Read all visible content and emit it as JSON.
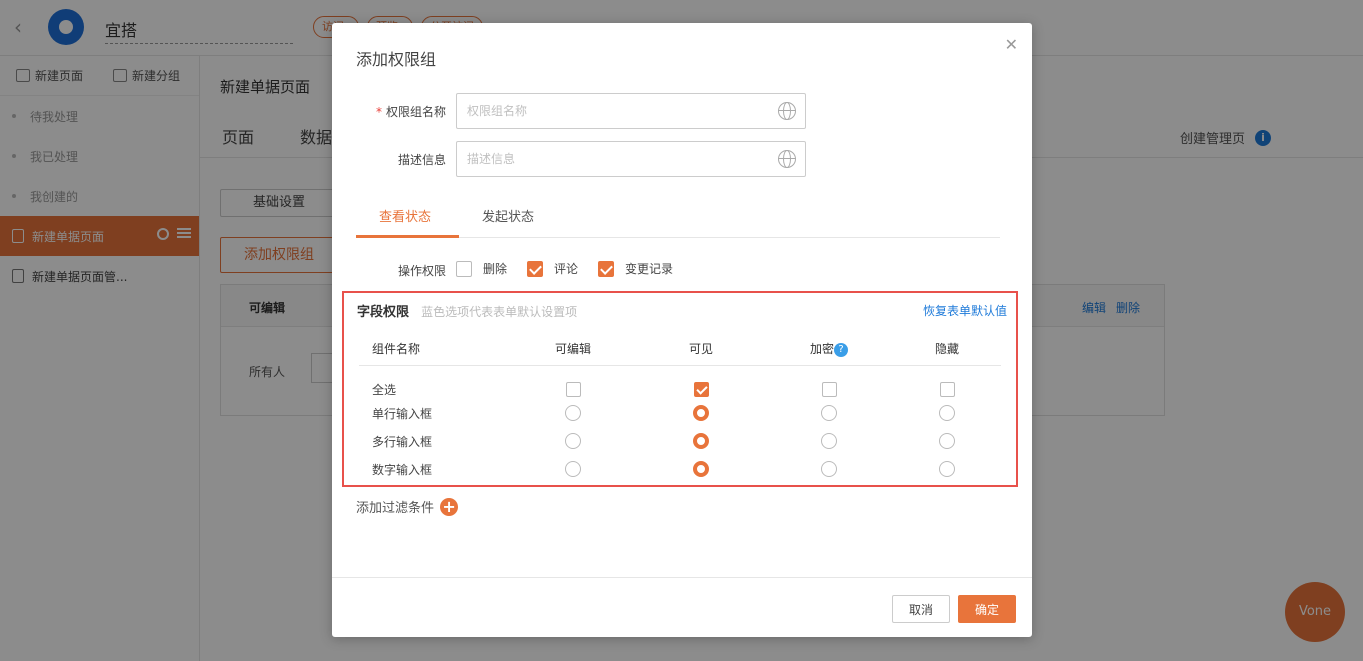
{
  "colors": {
    "accent": "#e8743b",
    "link": "#1e7ad9",
    "highlight_border": "#e8514b"
  },
  "app": {
    "title": "宜搭",
    "pills": [
      "访问",
      "预览",
      "公开访问"
    ]
  },
  "sidebar": {
    "new_page": "新建页面",
    "new_group": "新建分组",
    "items": [
      {
        "label": "待我处理"
      },
      {
        "label": "我已处理"
      },
      {
        "label": "我创建的"
      },
      {
        "label": "新建单据页面"
      },
      {
        "label": "新建单据页面管..."
      }
    ]
  },
  "main": {
    "page_name": "新建单据页面",
    "tabs": [
      "页面",
      "数据"
    ],
    "manage_link": "创建管理页",
    "basic_settings": "基础设置",
    "add_group": "添加权限组",
    "panel": {
      "col_editable": "可编辑",
      "edit": "编辑",
      "delete": "删除",
      "row_everyone": "所有人"
    }
  },
  "dialog": {
    "title": "添加权限组",
    "name_label": "权限组名称",
    "name_placeholder": "权限组名称",
    "desc_label": "描述信息",
    "desc_placeholder": "描述信息",
    "tabs": [
      "查看状态",
      "发起状态"
    ],
    "op_label": "操作权限",
    "ops": [
      {
        "label": "删除",
        "checked": false
      },
      {
        "label": "评论",
        "checked": true
      },
      {
        "label": "变更记录",
        "checked": true
      }
    ],
    "field_perm": {
      "title": "字段权限",
      "hint": "蓝色选项代表表单默认设置项",
      "reset": "恢复表单默认值",
      "headers": [
        "组件名称",
        "可编辑",
        "可见",
        "加密",
        "隐藏"
      ],
      "help_mark": "?",
      "rows": [
        {
          "name": "全选",
          "type": "checkbox",
          "selected": 1
        },
        {
          "name": "单行输入框",
          "type": "radio",
          "selected": 1
        },
        {
          "name": "多行输入框",
          "type": "radio",
          "selected": 1
        },
        {
          "name": "数字输入框",
          "type": "radio",
          "selected": 1
        }
      ]
    },
    "add_filter": "添加过滤条件",
    "cancel": "取消",
    "ok": "确定"
  },
  "assistant": "Vone"
}
